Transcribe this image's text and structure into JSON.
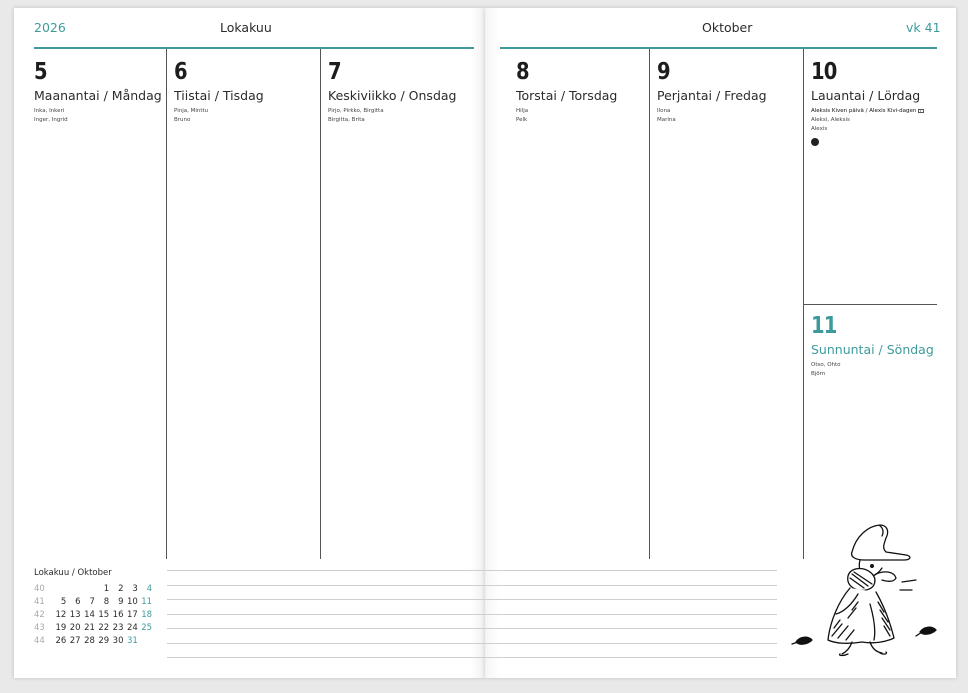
{
  "header": {
    "year": "2026",
    "month_fi": "Lokakuu",
    "month_sv": "Oktober",
    "week": "vk 41"
  },
  "days": [
    {
      "num": "5",
      "name": "Maanantai / Måndag",
      "names": [
        "Inka, Inkeri",
        "Inger, Ingrid"
      ]
    },
    {
      "num": "6",
      "name": "Tiistai / Tisdag",
      "names": [
        "Pinja, Minttu",
        "Bruno"
      ]
    },
    {
      "num": "7",
      "name": "Keskiviikko / Onsdag",
      "names": [
        "Pirjo, Pirkko, Birgitta",
        "Birgitta, Brita"
      ]
    },
    {
      "num": "8",
      "name": "Torstai / Torsdag",
      "names": [
        "Hilja",
        "Pelk"
      ]
    },
    {
      "num": "9",
      "name": "Perjantai / Fredag",
      "names": [
        "Ilona",
        "Marina"
      ]
    },
    {
      "num": "10",
      "name": "Lauantai / Lördag",
      "names": [
        "Aleksis Kiven päivä / Alexis Kivi-dagen",
        "Aleksi, Aleksis",
        "Alexis"
      ]
    },
    {
      "num": "11",
      "name": "Sunnuntai / Söndag",
      "names": [
        "Otso, Ohto",
        "Björn"
      ]
    }
  ],
  "mini_calendar": {
    "title": "Lokakuu / Oktober",
    "rows": [
      {
        "week": "40",
        "days": [
          "",
          "",
          "",
          "1",
          "2",
          "3",
          "4"
        ]
      },
      {
        "week": "41",
        "days": [
          "5",
          "6",
          "7",
          "8",
          "9",
          "10",
          "11"
        ]
      },
      {
        "week": "42",
        "days": [
          "12",
          "13",
          "14",
          "15",
          "16",
          "17",
          "18"
        ]
      },
      {
        "week": "43",
        "days": [
          "19",
          "20",
          "21",
          "22",
          "23",
          "24",
          "25"
        ]
      },
      {
        "week": "44",
        "days": [
          "26",
          "27",
          "28",
          "29",
          "30",
          "31",
          ""
        ]
      }
    ]
  },
  "colors": {
    "accent": "#3f9b9b",
    "rule": "#555555"
  },
  "illustration": "snufkin-walking-sketch"
}
